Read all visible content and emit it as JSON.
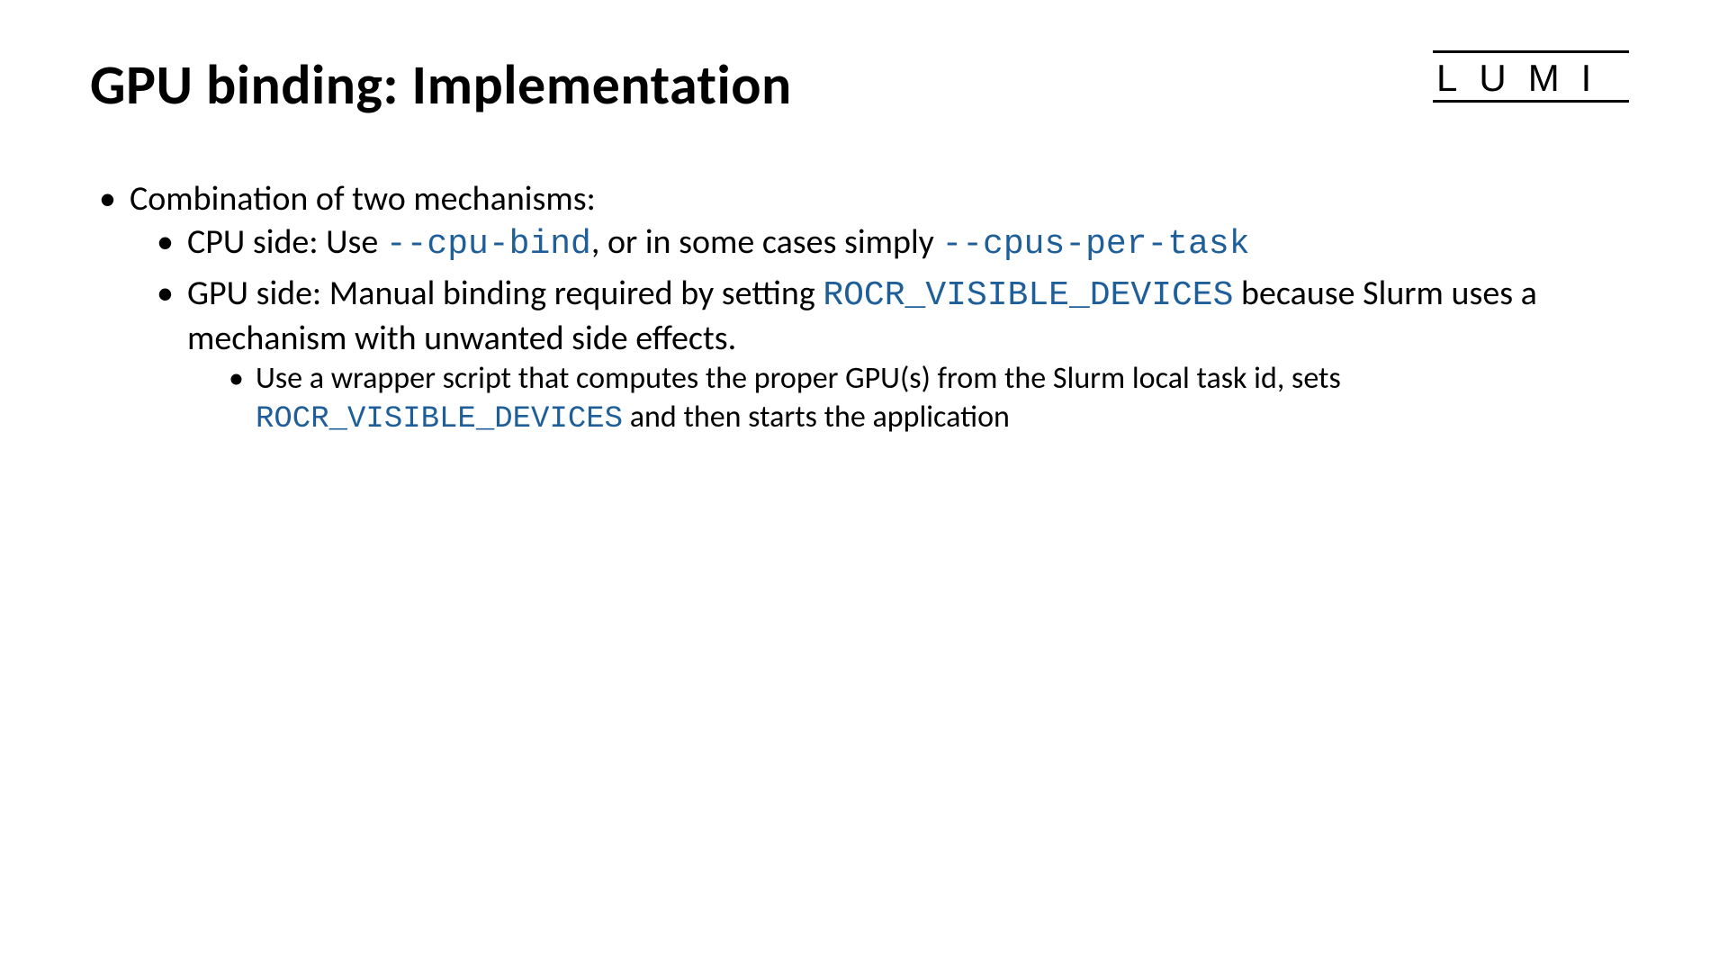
{
  "title": "GPU binding: Implementation",
  "logo": "LUMI",
  "bullets": {
    "l1": "Combination of two mechanisms:",
    "l2a_pre": "CPU side: Use ",
    "l2a_code1": "--cpu-bind",
    "l2a_mid": ", or in some cases simply ",
    "l2a_code2": "--cpus-per-task",
    "l2b_pre": "GPU side: Manual binding required by setting ",
    "l2b_code1": "ROCR_VISIBLE_DEVICES",
    "l2b_post": " because Slurm uses a mechanism with unwanted side effects.",
    "l3_pre": "Use a wrapper script that computes the proper GPU(s) from the Slurm local task id, sets ",
    "l3_code": "ROCR_VISIBLE_DEVICES",
    "l3_post": " and then starts the application"
  }
}
